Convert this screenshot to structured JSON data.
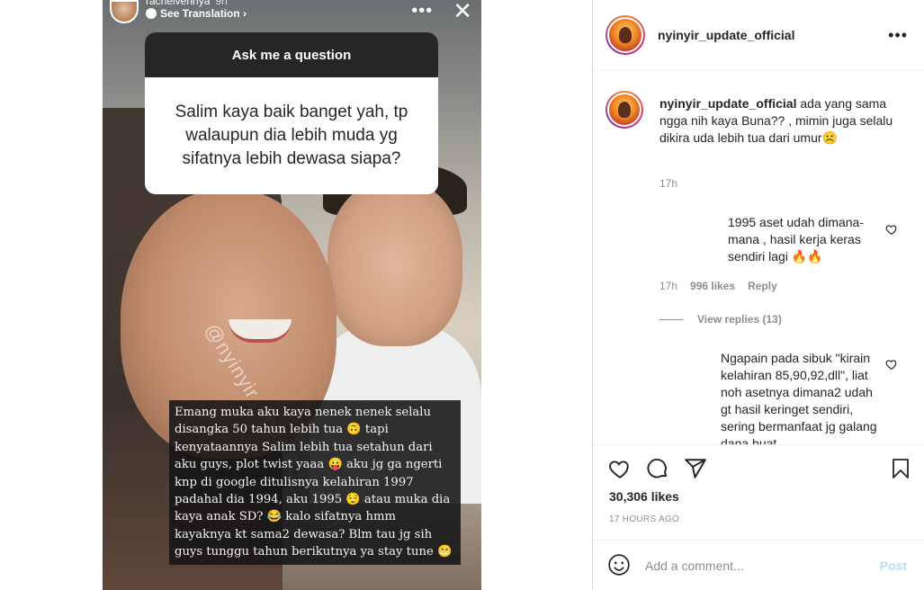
{
  "story": {
    "username": "rachelvennya",
    "time": "9h",
    "see_translation": "See Translation ›",
    "more_icon": "•••",
    "close_icon": "✕",
    "question_title": "Ask me a question",
    "question_text": "Salim kaya baik banget yah, tp walaupun dia lebih muda yg sifatnya lebih dewasa siapa?",
    "watermark": "@nyinyir_update_official",
    "answer_text": "Emang muka aku kaya nenek nenek selalu disangka 50 tahun lebih tua 🙃 tapi kenyataannya Salim lebih tua setahun dari aku guys, plot twist yaaa 😛 aku jg ga ngerti knp di google ditulisnya kelahiran 1997 padahal dia 1994, aku 1995 😌 atau muka dia kaya anak SD? 😂 kalo sifatnya hmm kayaknya kt sama2 dewasa? Blm tau jg sih guys tunggu tahun berikutnya ya stay tune 😬"
  },
  "header": {
    "username": "nyinyir_update_official",
    "more_icon": "•••"
  },
  "caption": {
    "username": "nyinyir_update_official",
    "text": "ada yang sama ngga nih kaya Buna?? , mimin juga selalu dikira uda lebih tua dari umur☹️",
    "time": "17h"
  },
  "comments": [
    {
      "text": "1995 aset udah dimana-mana , hasil kerja keras sendiri lagi 🔥🔥",
      "time": "17h",
      "likes": "996 likes",
      "reply": "Reply",
      "view_replies": "View replies (13)"
    },
    {
      "text": "Ngapain pada sibuk \"kirain kelahiran 85,90,92,dll\", liat noh asetnya dimana2 udah gt hasil keringet sendiri, sering bermanfaat jg galang dana buat"
    }
  ],
  "actions": {
    "icons": [
      "heart-icon",
      "comment-icon",
      "share-icon",
      "save-icon"
    ]
  },
  "likes_count": "30,306 likes",
  "timestamp": "17 HOURS AGO",
  "add_comment": {
    "placeholder": "Add a comment...",
    "post_label": "Post",
    "post_color": "#b2dffc"
  }
}
